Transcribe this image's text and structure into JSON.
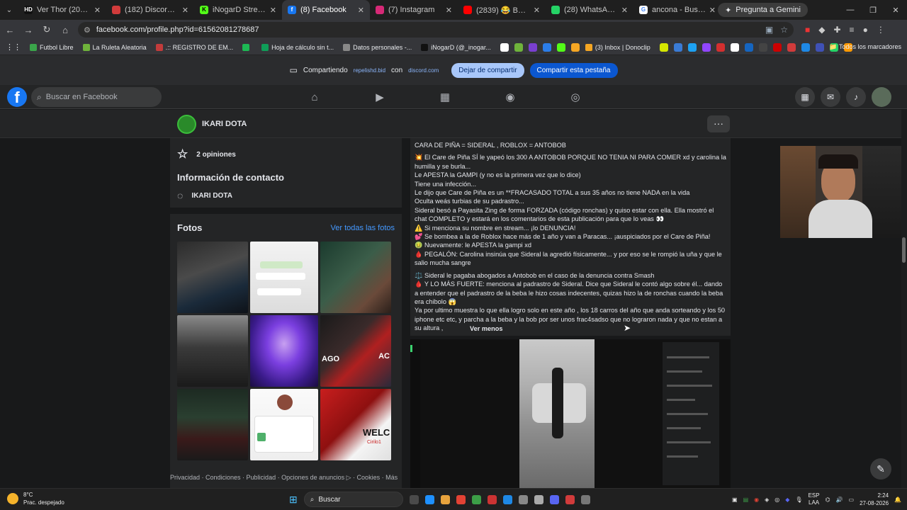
{
  "browser": {
    "tabs": [
      {
        "label": "Ver Thor (2011) Co",
        "fav_text": "HD",
        "color": "#111111"
      },
      {
        "label": "(182) Discord | Di",
        "fav_text": "",
        "color": "#d13b3b"
      },
      {
        "label": "iNogarD Stream - Wa",
        "fav_text": "K",
        "color": "#53fc18"
      },
      {
        "label": "(8) Facebook",
        "fav_text": "f",
        "color": "#1877f2"
      },
      {
        "label": "(7) Instagram",
        "fav_text": "",
        "color": "#d62976"
      },
      {
        "label": "(2839) 😂 BEBA: \"CR",
        "fav_text": "",
        "color": "#ff0000"
      },
      {
        "label": "(28) WhatsApp Busin",
        "fav_text": "",
        "color": "#25d366"
      },
      {
        "label": "ancona - Buscar con",
        "fav_text": "G",
        "color": "#ffffff"
      }
    ],
    "gemini_label": "Pregunta a Gemini",
    "url": "facebook.com/profile.php?id=61562081278687",
    "bookmarks": [
      {
        "label": "Futbol Libre",
        "color": "#3aa54a"
      },
      {
        "label": "La Ruleta Aleatoria",
        "color": "#6fb33b"
      },
      {
        "label": ".:: REGISTRO DE EM...",
        "color": "#c23b3b"
      },
      {
        "label": "",
        "color": "#1db954"
      },
      {
        "label": "Hoja de cálculo sin t...",
        "color": "#0f9d58"
      },
      {
        "label": "Datos personales -...",
        "color": "#888888"
      },
      {
        "label": "iNogarD (@_inogar...",
        "color": "#111111"
      }
    ],
    "bookmark_icons": [
      "#ffffff",
      "#6fb33b",
      "#7a3fd1",
      "#2b7de9",
      "#53fc18",
      "#f5a623"
    ],
    "bookmark_inbox": "(3) Inbox | Donoclip",
    "bookmark_tail_icons": [
      "#d4e600",
      "#3a7bd5",
      "#1da1f2",
      "#9146ff",
      "#d32f2f",
      "#ffffff",
      "#1565c0",
      "#444444",
      "#cc0000",
      "#d13b3b",
      "#1e88e5",
      "#3f51b5",
      "#25d366",
      "#ff9900"
    ],
    "all_bookmarks": "Todos los marcadores"
  },
  "sharebar": {
    "sharing_label": "Compartiendo",
    "site": "repelishd.bid",
    "with": "con",
    "target": "discord.com",
    "stop_label": "Dejar de compartir",
    "share_label": "Compartir esta pestaña"
  },
  "facebook": {
    "search_placeholder": "Buscar en Facebook",
    "profile_name": "IKARI DOTA",
    "rating_text": "2 opiniones",
    "contact_heading": "Información de contacto",
    "contact_messenger": "IKARI DOTA",
    "photos_heading": "Fotos",
    "photos_link": "Ver todas las fotos",
    "photo_captions": {
      "cell9": "WELC",
      "cell9b": "Cirilo1",
      "cell6": "AGO",
      "cell6b": "AC"
    },
    "footer": "Privacidad · Condiciones · Publicidad · Opciones de anuncios ▷ · Cookies · Más",
    "post": {
      "title": "CARA DE PIÑA = SIDERAL , ROBLOX = ANTOBOB",
      "lines": [
        "💥 El Care de Piña SÍ le yapeó los 300 A ANTOBOB PORQUE NO TENIA NI PARA COMER xd y carolina la humilla y se burla...",
        " Le APESTA la GAMPI (y no es la primera vez que lo dice)",
        " Tiene una infección...",
        " Le dijo que Care de Piña es un **FRACASADO TOTAL a sus 35 años no tiene NADA en la vida",
        " Oculta weás turbias de su padrastro...",
        " Sideral besó a Payasita Zing de forma FORZADA (código ronchas) y quiso estar con ella. Ella mostró el chat COMPLETO y estará en los comentarios de esta publicación para que lo veas 👀",
        "⚠️ Si menciona su nombre en stream... ¡lo DENUNCIA!",
        "💕 Se bombea a la de Roblox hace más de 1 año y van a Paracas... ¡auspiciados por el Care de Piña!",
        "🤢 Nuevamente: le APESTA la gampi xd",
        "🩸 PEGALÓN: Carolina insinúa que Sideral la agredió físicamente... y por eso se le rompió la uña y que le salio  mucha sangre"
      ],
      "lines2": [
        "⚖️ Sideral le pagaba abogados a Antobob en el caso de la denuncia contra Smash",
        "🩸 Y LO MÁS FUERTE: menciona al padrastro de Sideral. Dice que Sideral le contó algo sobre él... dando a entender que el padrastro de la beba le hizo cosas indecentes, quizas hizo la de ronchas cuando la beba era chibolo 😱",
        "Ya por ultimo muestra lo que ella logro solo en este año , los  18 carros del año que anda sorteando y los 50 iphone etc etc, y parcha a la beba y la bob por ser unos frac4sadso que no lograron nada y que no estan a su altura ,"
      ],
      "see_less": "Ver menos"
    }
  },
  "taskbar": {
    "temp": "8°C",
    "weather": "Prac. despejado",
    "search": "Buscar",
    "lang1": "ESP",
    "lang2": "LAA",
    "time": "2:24",
    "date": "27-08-2026",
    "app_icons": [
      "#4a4a4a",
      "#1e90ff",
      "#e8a33d",
      "#e34234",
      "#3c9e47",
      "#cc3333",
      "#1e88e5",
      "#888888",
      "#aaaaaa",
      "#5865f2",
      "#d13b3b",
      "#777777"
    ]
  }
}
